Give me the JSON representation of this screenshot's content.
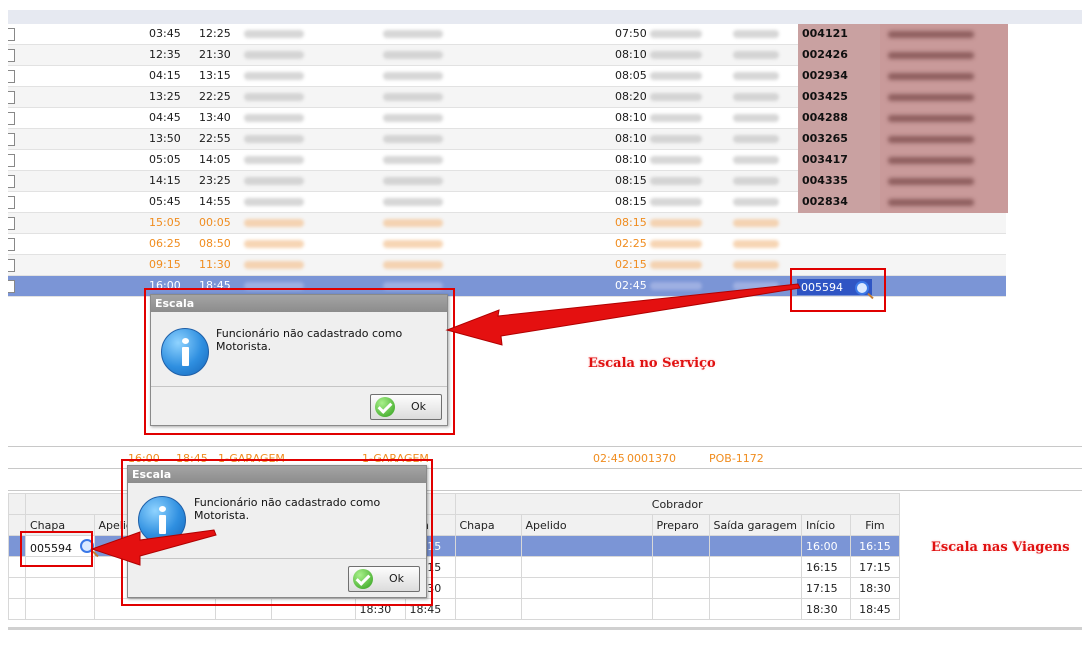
{
  "service_rows": [
    {
      "start": "03:45",
      "end": "12:25",
      "time2": "07:50",
      "chapa": "004121",
      "style": "normal"
    },
    {
      "start": "12:35",
      "end": "21:30",
      "time2": "08:10",
      "chapa": "002426",
      "style": "normal"
    },
    {
      "start": "04:15",
      "end": "13:15",
      "time2": "08:05",
      "chapa": "002934",
      "style": "normal"
    },
    {
      "start": "13:25",
      "end": "22:25",
      "time2": "08:20",
      "chapa": "003425",
      "style": "normal"
    },
    {
      "start": "04:45",
      "end": "13:40",
      "time2": "08:10",
      "chapa": "004288",
      "style": "normal"
    },
    {
      "start": "13:50",
      "end": "22:55",
      "time2": "08:10",
      "chapa": "003265",
      "style": "normal"
    },
    {
      "start": "05:05",
      "end": "14:05",
      "time2": "08:10",
      "chapa": "003417",
      "style": "normal"
    },
    {
      "start": "14:15",
      "end": "23:25",
      "time2": "08:15",
      "chapa": "004335",
      "style": "normal"
    },
    {
      "start": "05:45",
      "end": "14:55",
      "time2": "08:15",
      "chapa": "002834",
      "style": "normal"
    },
    {
      "start": "15:05",
      "end": "00:05",
      "time2": "08:15",
      "chapa": "",
      "style": "orange"
    },
    {
      "start": "06:25",
      "end": "08:50",
      "time2": "02:25",
      "chapa": "",
      "style": "orange"
    },
    {
      "start": "09:15",
      "end": "11:30",
      "time2": "02:15",
      "chapa": "",
      "style": "orange"
    },
    {
      "start": "16:00",
      "end": "18:45",
      "time2": "02:45",
      "chapa": "",
      "style": "selected"
    }
  ],
  "edit_chapa": "005594",
  "dialog_top": {
    "title": "Escala",
    "message": "Funcionário não cadastrado como Motorista.",
    "ok_label": "Ok"
  },
  "dialog_bottom": {
    "title": "Escala",
    "message": "Funcionário não cadastrado como Motorista.",
    "ok_label": "Ok"
  },
  "annotation_service": "Escala no Serviço",
  "annotation_trips": "Escala nas Viagens",
  "middle_line": {
    "t1": "16:00",
    "t2": "18:45",
    "garage1": "1-GARAGEM",
    "garage2": "1-GARAGEM",
    "duration": "02:45",
    "code": "0001370",
    "plate": "POB-1172"
  },
  "trips_table": {
    "group_cobrador": "Cobrador",
    "headers": {
      "chapa": "Chapa",
      "apelido": "Apelido",
      "fim_left": "Fim",
      "chapa2": "Chapa",
      "apelido2": "Apelido",
      "preparo": "Preparo",
      "saida_garagem": "Saída garagem",
      "inicio": "Início",
      "fim": "Fim"
    },
    "first_chapa": "005594",
    "rows": [
      {
        "a": "",
        "b": "16:15",
        "inicio": "16:00",
        "fim": "16:15"
      },
      {
        "a": "",
        "b": "17:15",
        "inicio": "16:15",
        "fim": "17:15"
      },
      {
        "a": "",
        "b": "18:30",
        "inicio": "17:15",
        "fim": "18:30"
      },
      {
        "a": "18:30",
        "b": "18:45",
        "inicio": "18:30",
        "fim": "18:45"
      }
    ]
  }
}
